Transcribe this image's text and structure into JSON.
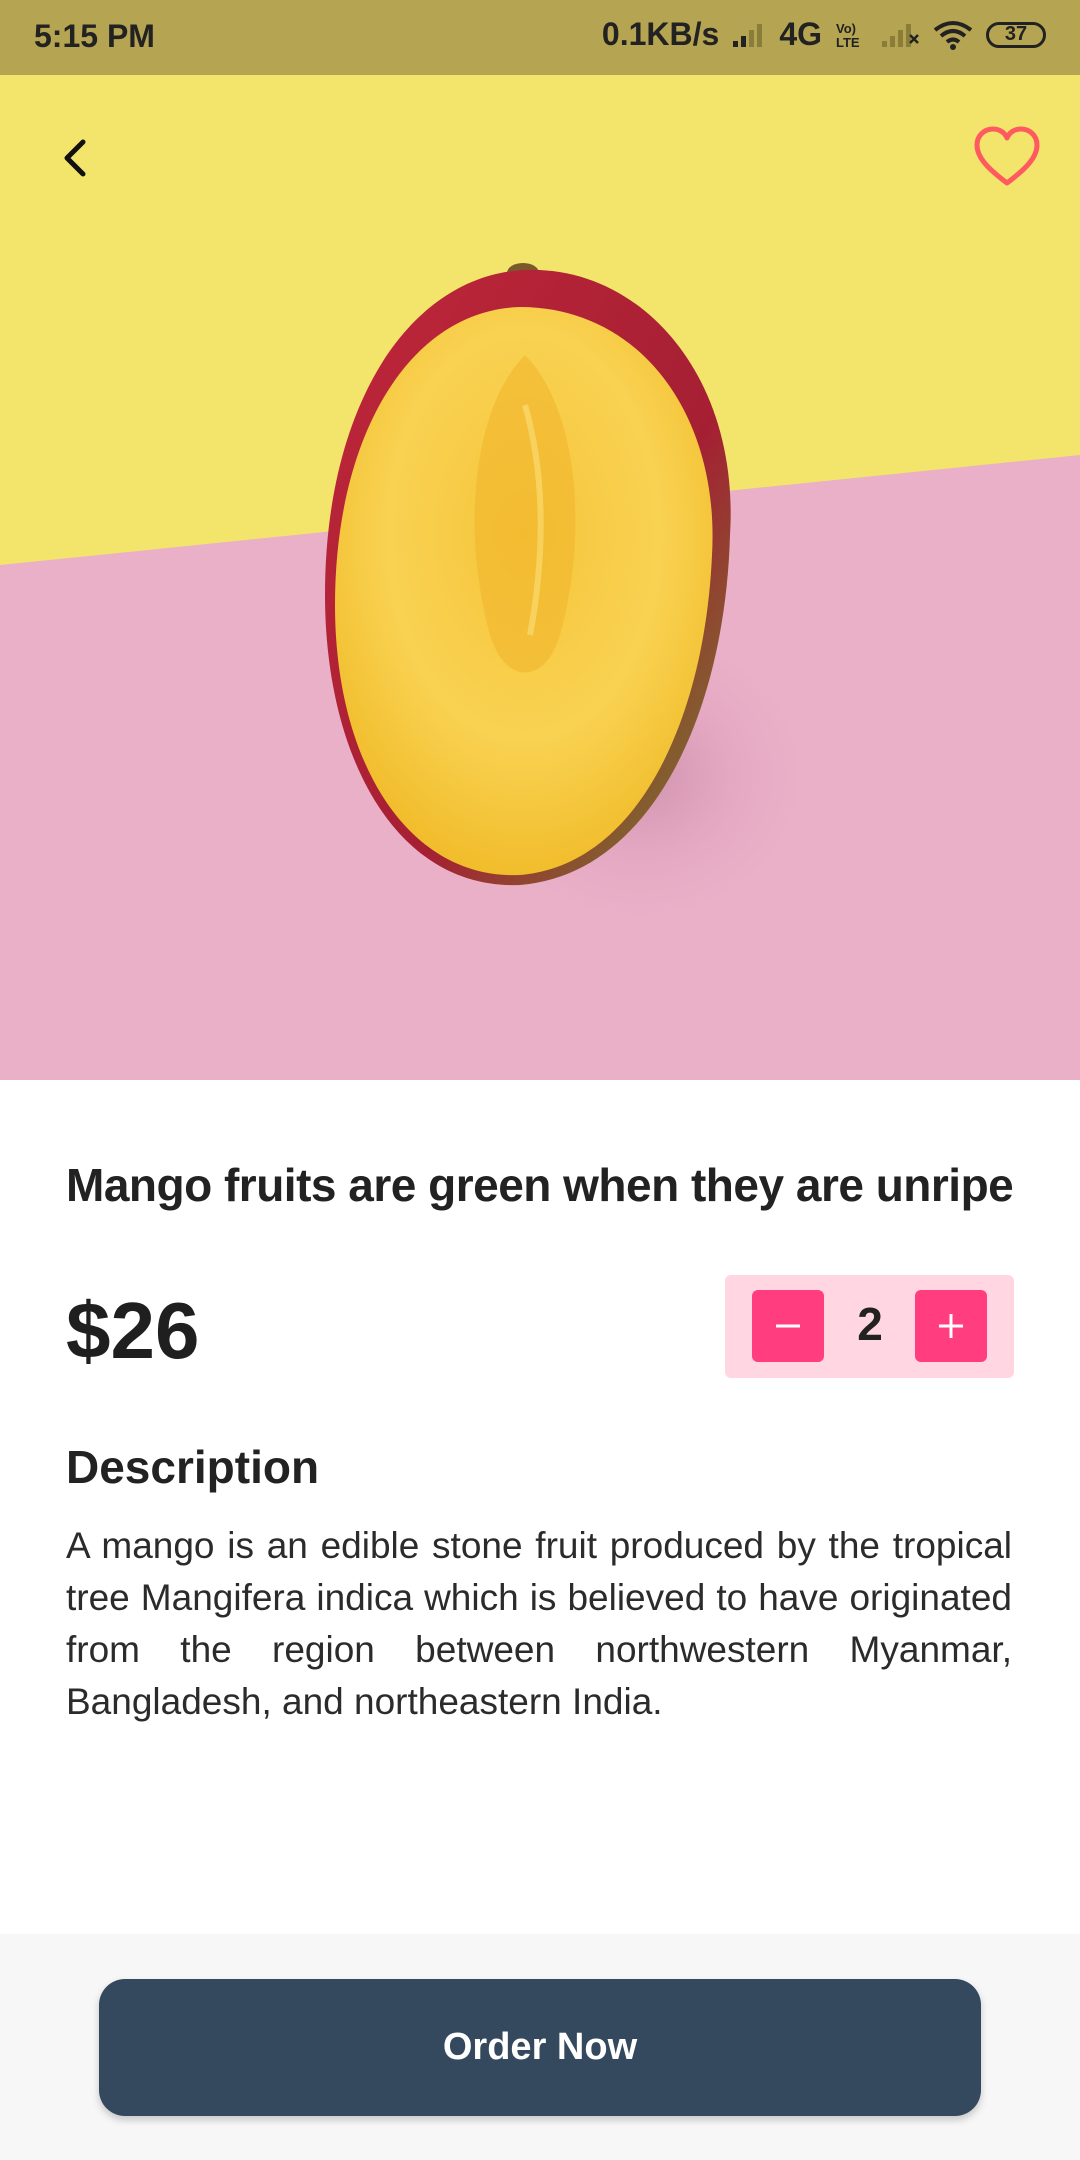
{
  "status_bar": {
    "time": "5:15 PM",
    "network_speed": "0.1KB/s",
    "network_type": "4G",
    "volte": "Vo) LTE",
    "battery": "37",
    "icons": [
      "signal-icon",
      "volte-icon",
      "wifi-icon",
      "battery-icon"
    ]
  },
  "header": {
    "back_icon": "chevron-left-icon",
    "favorite_icon": "heart-outline-icon",
    "favorite_color": "#ff5a5f"
  },
  "product": {
    "title": "Mango fruits are green when they are unripe",
    "price": "$26",
    "quantity": {
      "minus_label": "−",
      "value": "2",
      "plus_label": "+"
    },
    "description_heading": "Description",
    "description": "A mango is an edible stone fruit produced by the tropical tree Mangifera indica which is believed to have originated from the region between northwestern Myanmar, Bangladesh, and northeastern India."
  },
  "actions": {
    "order_label": "Order Now"
  },
  "colors": {
    "accent": "#ff3d7f",
    "qty_bg": "#ffd6e2",
    "order_button": "#34495e",
    "status_bar": "#b5a451"
  }
}
